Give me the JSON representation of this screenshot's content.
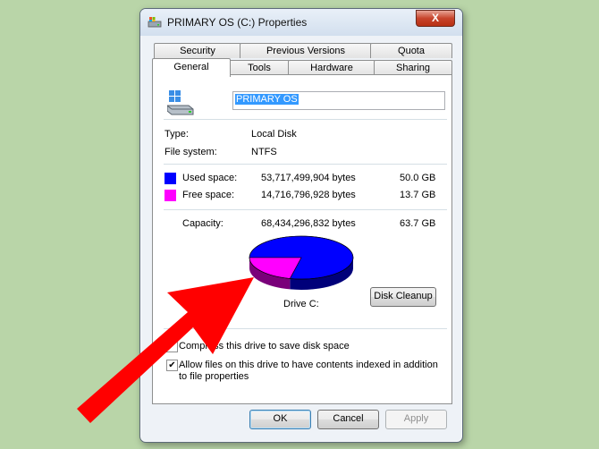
{
  "window": {
    "title": "PRIMARY OS (C:) Properties",
    "close_glyph": "X"
  },
  "tabs": {
    "row_back": [
      "Security",
      "Previous Versions",
      "Quota"
    ],
    "row_front": [
      "General",
      "Tools",
      "Hardware",
      "Sharing"
    ],
    "active": "General"
  },
  "general": {
    "drive_name": "PRIMARY OS",
    "type_label": "Type:",
    "type_value": "Local Disk",
    "fs_label": "File system:",
    "fs_value": "NTFS",
    "used_label": "Used space:",
    "used_bytes": "53,717,499,904 bytes",
    "used_gb": "50.0 GB",
    "free_label": "Free space:",
    "free_bytes": "14,716,796,928 bytes",
    "free_gb": "13.7 GB",
    "capacity_label": "Capacity:",
    "capacity_bytes": "68,434,296,832 bytes",
    "capacity_gb": "63.7 GB",
    "drive_label": "Drive C:",
    "disk_cleanup": "Disk Cleanup",
    "compress_label": "Compress this drive to save disk space",
    "compress_checked": false,
    "index_label_line1": "Allow files on this drive to have contents indexed in addition",
    "index_label_line2": "to file properties",
    "index_checked": true
  },
  "usage": {
    "used_fraction": 0.785,
    "free_fraction": 0.215
  },
  "colors": {
    "used": "#0000ff",
    "free": "#ff00ff",
    "annotation_arrow": "#ff0000"
  },
  "footer": {
    "ok": "OK",
    "cancel": "Cancel",
    "apply": "Apply"
  },
  "icons": {
    "title": "drive-icon",
    "close": "close-icon",
    "drive": "hard-drive-icon",
    "check": "checkmark-icon",
    "arrow": "annotation-arrow"
  }
}
